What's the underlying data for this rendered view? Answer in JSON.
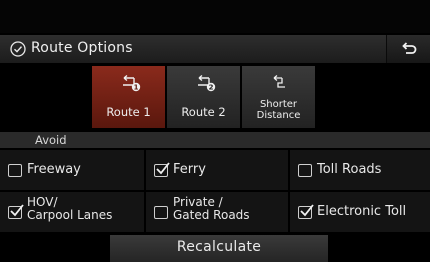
{
  "header": {
    "title": "Route Options",
    "back_icon": "back-arrow-icon"
  },
  "routes": [
    {
      "label": "Route 1",
      "icon": "route-1-icon",
      "selected": true
    },
    {
      "label": "Route 2",
      "icon": "route-2-icon",
      "selected": false
    },
    {
      "label_line1": "Shorter",
      "label_line2": "Distance",
      "icon": "shorter-distance-icon",
      "selected": false
    }
  ],
  "avoid": {
    "label": "Avoid",
    "options": [
      {
        "label": "Freeway",
        "checked": false
      },
      {
        "label": "Ferry",
        "checked": true
      },
      {
        "label": "Toll Roads",
        "checked": false
      },
      {
        "label_line1": "HOV/",
        "label_line2": "Carpool Lanes",
        "checked": true
      },
      {
        "label_line1": "Private /",
        "label_line2": "Gated Roads",
        "checked": false
      },
      {
        "label": "Electronic Toll",
        "checked": true
      }
    ]
  },
  "recalculate_label": "Recalculate",
  "colors": {
    "accent": "#8a2a1c",
    "background": "#000000",
    "text": "#e6e6e6"
  }
}
